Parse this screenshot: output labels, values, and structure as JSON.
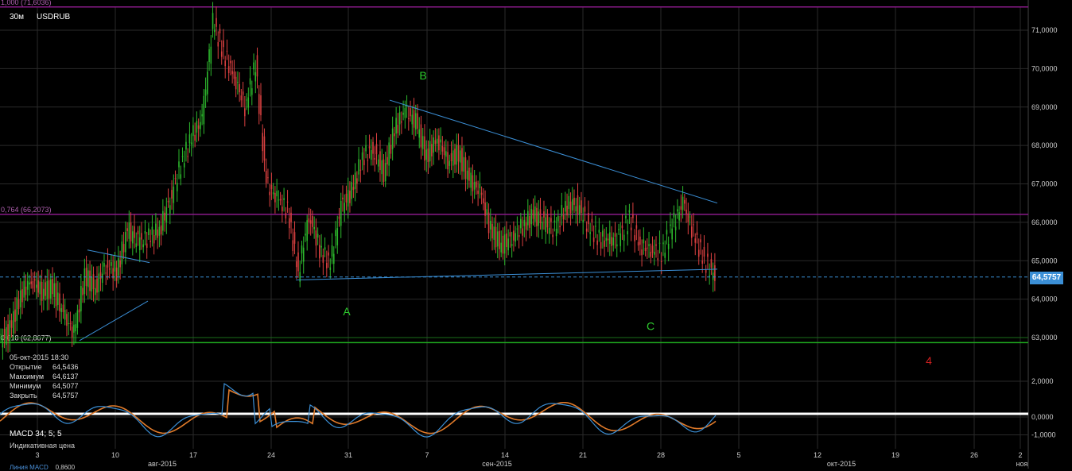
{
  "header": {
    "timeframe": "30м",
    "symbol": "USDRUB"
  },
  "colors": {
    "background": "#000000",
    "grid": "#2a2a2a",
    "up_candle": "#2db82d",
    "down_candle": "#d94040",
    "trendline": "#3b8fd6",
    "fib_line": "#8a1a8a",
    "support_line": "#1fae1f",
    "wave_label": "#2ecc2e",
    "wave4_label": "#d42020",
    "price_tag": "#3b8fd6",
    "macd_line": "#3b8fd6",
    "signal_line": "#e07a2a"
  },
  "info_panel": {
    "datetime": "05-окт-2015 18:30",
    "rows": [
      {
        "label": "Открытие",
        "value": "64,5436"
      },
      {
        "label": "Максимум",
        "value": "64,6137"
      },
      {
        "label": "Минимум",
        "value": "64,5077"
      },
      {
        "label": "Закрыть",
        "value": "64,5757"
      }
    ]
  },
  "current_price": "64,5757",
  "macd": {
    "label": "MACD 34; 5; 5",
    "sub_label": "Индикативная цена",
    "footer_label": "Линия MACD",
    "footer_value": "0,8600",
    "y_ticks": [
      "2,0000",
      "0,0000",
      "-1,0000"
    ]
  },
  "chart_data": {
    "type": "candlestick",
    "ylim": [
      62.0,
      71.6
    ],
    "y_ticks": [
      "71,0000",
      "70,0000",
      "69,0000",
      "68,0000",
      "67,0000",
      "66,0000",
      "65,0000",
      "64,0000",
      "63,0000"
    ],
    "y_tick_values": [
      71,
      70,
      69,
      68,
      67,
      66,
      65,
      64,
      63
    ],
    "x_ticks": [
      "3",
      "10",
      "17",
      "24",
      "31",
      "7",
      "14",
      "21",
      "28",
      "5",
      "12",
      "19",
      "26",
      "2"
    ],
    "x_month_labels": [
      "авг-2015",
      "сен-2015",
      "окт-2015",
      "ноя"
    ],
    "fib_levels": [
      {
        "label": "1,000 (71,6036)",
        "value": 71.6036
      },
      {
        "label": "0,764 (66,2073)",
        "value": 66.2073
      },
      {
        "label": "0,618 (62,8677)",
        "value": 62.8677
      }
    ],
    "wave_labels": [
      "A",
      "B",
      "C",
      "4"
    ],
    "series": [
      {
        "name": "USDRUB",
        "close": [
          62.9,
          63.2,
          64.1,
          64.5,
          64.2,
          64.3,
          63.6,
          63.1,
          64.6,
          64.3,
          64.9,
          64.7,
          65.8,
          65.5,
          65.6,
          65.8,
          66.6,
          67.5,
          68.2,
          68.7,
          71.2,
          70.4,
          69.8,
          69.0,
          70.1,
          67.0,
          66.6,
          66.3,
          64.7,
          66.2,
          65.3,
          64.9,
          66.4,
          66.8,
          67.7,
          67.9,
          67.3,
          68.4,
          68.9,
          68.6,
          67.7,
          68.2,
          67.6,
          67.8,
          67.1,
          66.8,
          65.8,
          65.4,
          65.6,
          65.9,
          66.2,
          66.0,
          65.8,
          66.4,
          66.5,
          66.0,
          65.6,
          65.5,
          65.6,
          66.1,
          65.4,
          65.3,
          65.2,
          65.9,
          66.5,
          65.7,
          65.0,
          64.6
        ]
      }
    ]
  }
}
